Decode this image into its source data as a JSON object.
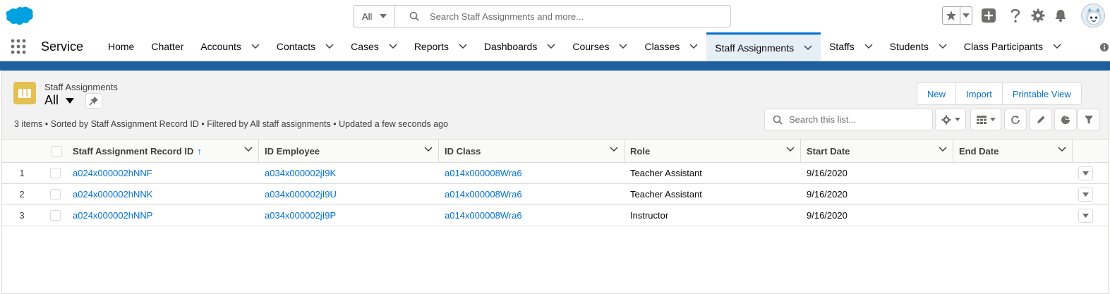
{
  "header": {
    "search_scope": "All",
    "search_placeholder": "Search Staff Assignments and more..."
  },
  "nav": {
    "app_name": "Service",
    "items": [
      {
        "label": "Home",
        "has_menu": false
      },
      {
        "label": "Chatter",
        "has_menu": false
      },
      {
        "label": "Accounts",
        "has_menu": true
      },
      {
        "label": "Contacts",
        "has_menu": true
      },
      {
        "label": "Cases",
        "has_menu": true
      },
      {
        "label": "Reports",
        "has_menu": true
      },
      {
        "label": "Dashboards",
        "has_menu": true
      },
      {
        "label": "Courses",
        "has_menu": true
      },
      {
        "label": "Classes",
        "has_menu": true
      },
      {
        "label": "Staff Assignments",
        "has_menu": true,
        "active": true
      },
      {
        "label": "Staffs",
        "has_menu": true
      },
      {
        "label": "Students",
        "has_menu": true
      },
      {
        "label": "Class Participants",
        "has_menu": true
      }
    ]
  },
  "list_view": {
    "object_label": "Staff Assignments",
    "view_name": "All",
    "info": "3 items • Sorted by Staff Assignment Record ID • Filtered by All staff assignments • Updated a few seconds ago",
    "buttons": {
      "new": "New",
      "import": "Import",
      "printable": "Printable View"
    },
    "search_placeholder": "Search this list...",
    "columns": [
      "Staff Assignment Record ID",
      "ID Employee",
      "ID Class",
      "Role",
      "Start Date",
      "End Date"
    ],
    "rows": [
      {
        "num": "1",
        "record_id": "a024x000002hNNF",
        "employee": "a034x000002jI9K",
        "class": "a014x000008Wra6",
        "role": "Teacher Assistant",
        "start": "9/16/2020",
        "end": ""
      },
      {
        "num": "2",
        "record_id": "a024x000002hNNK",
        "employee": "a034x000002jI9U",
        "class": "a014x000008Wra6",
        "role": "Teacher Assistant",
        "start": "9/16/2020",
        "end": ""
      },
      {
        "num": "3",
        "record_id": "a024x000002hNNP",
        "employee": "a034x000002jI9P",
        "class": "a014x000008Wra6",
        "role": "Instructor",
        "start": "9/16/2020",
        "end": ""
      }
    ]
  },
  "colors": {
    "brand": "#0070d2",
    "band": "#1e5f9e",
    "object_icon": "#e3c052"
  }
}
